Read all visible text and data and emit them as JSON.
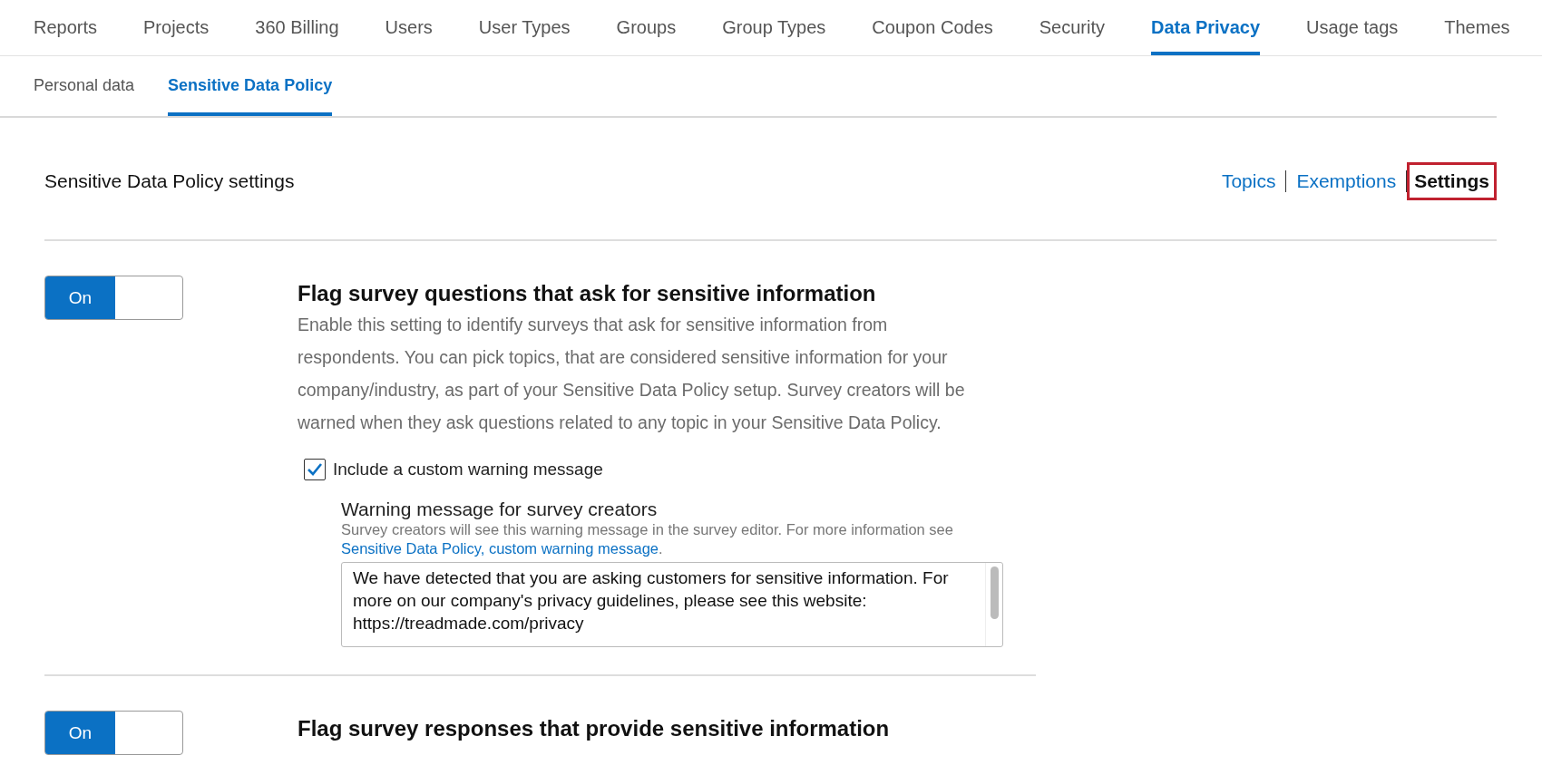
{
  "main_tabs": [
    {
      "label": "Reports",
      "selected": false
    },
    {
      "label": "Projects",
      "selected": false
    },
    {
      "label": "360 Billing",
      "selected": false
    },
    {
      "label": "Users",
      "selected": false
    },
    {
      "label": "User Types",
      "selected": false
    },
    {
      "label": "Groups",
      "selected": false
    },
    {
      "label": "Group Types",
      "selected": false
    },
    {
      "label": "Coupon Codes",
      "selected": false
    },
    {
      "label": "Security",
      "selected": false
    },
    {
      "label": "Data Privacy",
      "selected": true
    },
    {
      "label": "Usage tags",
      "selected": false
    },
    {
      "label": "Themes",
      "selected": false
    }
  ],
  "sub_tabs": [
    {
      "label": "Personal data",
      "selected": false
    },
    {
      "label": "Sensitive Data Policy",
      "selected": true
    }
  ],
  "header": {
    "title": "Sensitive Data Policy settings",
    "links": [
      {
        "label": "Topics",
        "selected": false
      },
      {
        "label": "Exemptions",
        "selected": false
      },
      {
        "label": "Settings",
        "selected": true
      }
    ]
  },
  "settings": [
    {
      "toggle": {
        "label": "On",
        "on": true
      },
      "title": "Flag survey questions that ask for sensitive information",
      "description": "Enable this setting to identify surveys that ask for sensitive information from respondents. You can pick topics, that are considered sensitive information for your company/industry, as part of your Sensitive Data Policy setup. Survey creators will be warned when they ask questions related to any topic in your Sensitive Data Policy.",
      "checkbox": {
        "label": "Include a custom warning message",
        "checked": true
      },
      "warning": {
        "title": "Warning message for survey creators",
        "help": "Survey creators will see this warning message in the survey editor. For more information see",
        "link": "Sensitive Data Policy, custom warning message",
        "link_suffix": ".",
        "value": "We have detected that you are asking customers for sensitive information. For more on our company's privacy guidelines, please see this website: https://treadmade.com/privacy"
      }
    },
    {
      "toggle": {
        "label": "On",
        "on": true
      },
      "title": "Flag survey responses that provide sensitive information"
    }
  ]
}
